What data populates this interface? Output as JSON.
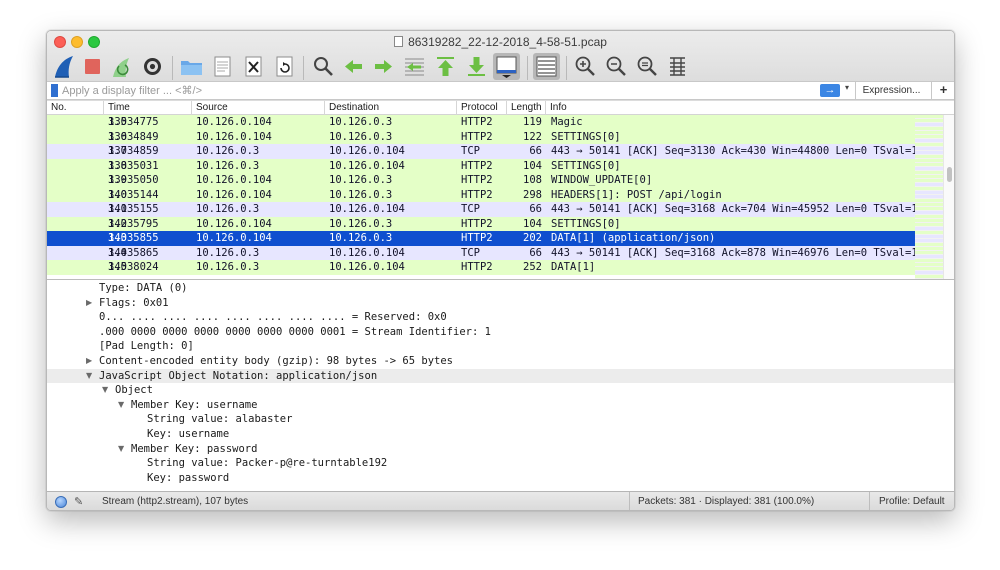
{
  "window": {
    "title": "86319282_22-12-2018_4-58-51.pcap"
  },
  "filter": {
    "placeholder": "Apply a display filter ... <⌘/>",
    "apply_icon": "→",
    "dropdown_icon": "▾",
    "expression_label": "Expression...",
    "add_label": "+"
  },
  "packet_list": {
    "columns": [
      "No.",
      "Time",
      "Source",
      "Destination",
      "Protocol",
      "Length",
      "Info"
    ],
    "rows": [
      {
        "no": "135",
        "time": "3.034775",
        "src": "10.126.0.104",
        "dst": "10.126.0.3",
        "proto": "HTTP2",
        "len": "119",
        "info": "Magic",
        "color": "#e4ffc7"
      },
      {
        "no": "136",
        "time": "3.034849",
        "src": "10.126.0.104",
        "dst": "10.126.0.3",
        "proto": "HTTP2",
        "len": "122",
        "info": "SETTINGS[0]",
        "color": "#e4ffc7"
      },
      {
        "no": "137",
        "time": "3.034859",
        "src": "10.126.0.3",
        "dst": "10.126.0.104",
        "proto": "TCP",
        "len": "66",
        "info": "443 → 50141 [ACK] Seq=3130 Ack=430 Win=44800 Len=0 TSval=1",
        "color": "#e7e6ff"
      },
      {
        "no": "138",
        "time": "3.035031",
        "src": "10.126.0.3",
        "dst": "10.126.0.104",
        "proto": "HTTP2",
        "len": "104",
        "info": "SETTINGS[0]",
        "color": "#e4ffc7"
      },
      {
        "no": "139",
        "time": "3.035050",
        "src": "10.126.0.104",
        "dst": "10.126.0.3",
        "proto": "HTTP2",
        "len": "108",
        "info": "WINDOW_UPDATE[0]",
        "color": "#e4ffc7"
      },
      {
        "no": "140",
        "time": "3.035144",
        "src": "10.126.0.104",
        "dst": "10.126.0.3",
        "proto": "HTTP2",
        "len": "298",
        "info": "HEADERS[1]: POST /api/login",
        "color": "#e4ffc7"
      },
      {
        "no": "141",
        "time": "3.035155",
        "src": "10.126.0.3",
        "dst": "10.126.0.104",
        "proto": "TCP",
        "len": "66",
        "info": "443 → 50141 [ACK] Seq=3168 Ack=704 Win=45952 Len=0 TSval=1",
        "color": "#e7e6ff"
      },
      {
        "no": "142",
        "time": "3.035795",
        "src": "10.126.0.104",
        "dst": "10.126.0.3",
        "proto": "HTTP2",
        "len": "104",
        "info": "SETTINGS[0]",
        "color": "#e4ffc7"
      },
      {
        "no": "143",
        "time": "3.035855",
        "src": "10.126.0.104",
        "dst": "10.126.0.3",
        "proto": "HTTP2",
        "len": "202",
        "info": "DATA[1] (application/json)",
        "color": "#0f4fcf",
        "selected": true
      },
      {
        "no": "144",
        "time": "3.035865",
        "src": "10.126.0.3",
        "dst": "10.126.0.104",
        "proto": "TCP",
        "len": "66",
        "info": "443 → 50141 [ACK] Seq=3168 Ack=878 Win=46976 Len=0 TSval=1",
        "color": "#e7e6ff"
      },
      {
        "no": "145",
        "time": "3.038024",
        "src": "10.126.0.3",
        "dst": "10.126.0.104",
        "proto": "HTTP2",
        "len": "252",
        "info": "DATA[1]",
        "color": "#e4ffc7"
      }
    ]
  },
  "details": [
    {
      "indent": 0,
      "toggle": "",
      "text": "Type: DATA (0)"
    },
    {
      "indent": 0,
      "toggle": "▶",
      "text": "Flags: 0x01"
    },
    {
      "indent": 0,
      "toggle": "",
      "text": "0... .... .... .... .... .... .... .... = Reserved: 0x0"
    },
    {
      "indent": 0,
      "toggle": "",
      "text": ".000 0000 0000 0000 0000 0000 0000 0001 = Stream Identifier: 1"
    },
    {
      "indent": 0,
      "toggle": "",
      "text": "[Pad Length: 0]"
    },
    {
      "indent": 0,
      "toggle": "▶",
      "text": "Content-encoded entity body (gzip): 98 bytes -> 65 bytes"
    },
    {
      "indent": 0,
      "toggle": "▼",
      "text": "JavaScript Object Notation: application/json",
      "highlight": true
    },
    {
      "indent": 1,
      "toggle": "▼",
      "text": "Object"
    },
    {
      "indent": 2,
      "toggle": "▼",
      "text": "Member Key: username"
    },
    {
      "indent": 3,
      "toggle": "",
      "text": "String value: alabaster"
    },
    {
      "indent": 3,
      "toggle": "",
      "text": "Key: username"
    },
    {
      "indent": 2,
      "toggle": "▼",
      "text": "Member Key: password"
    },
    {
      "indent": 3,
      "toggle": "",
      "text": "String value: Packer-p@re-turntable192"
    },
    {
      "indent": 3,
      "toggle": "",
      "text": "Key: password"
    }
  ],
  "status": {
    "stream_text": "Stream (http2.stream), 107 bytes",
    "packets_text": "Packets: 381 · Displayed: 381 (100.0%)",
    "profile_text": "Profile: Default"
  },
  "colors": {
    "http2_row": "#e4ffc7",
    "tcp_row": "#e7e6ff",
    "selected_row": "#0f4fcf"
  },
  "toolbar_icons": [
    "shark-fin-start-icon",
    "stop-capture-icon",
    "restart-capture-icon",
    "capture-options-icon",
    "open-file-icon",
    "save-file-icon",
    "close-file-icon",
    "reload-file-icon",
    "find-packet-icon",
    "go-back-icon",
    "go-forward-icon",
    "go-to-packet-icon",
    "go-first-icon",
    "go-last-icon",
    "auto-scroll-icon",
    "colorize-icon",
    "zoom-in-icon",
    "zoom-out-icon",
    "zoom-normal-icon",
    "resize-columns-icon"
  ]
}
